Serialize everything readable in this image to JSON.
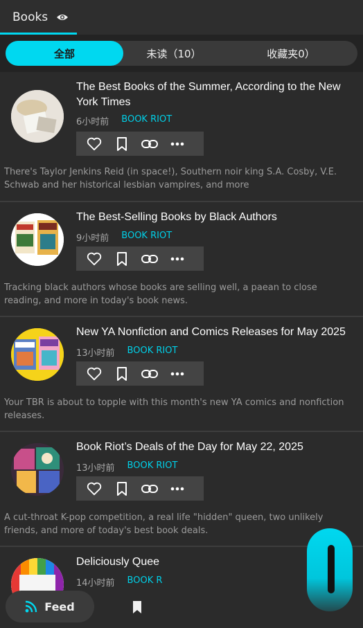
{
  "header": {
    "tab_label": "Books",
    "tab_icon": "eye-icon"
  },
  "filters": {
    "all": "全部",
    "unread": "未读（10）",
    "favorites": "收藏夹0）"
  },
  "accent": "#00d8f0",
  "articles": [
    {
      "title": "The Best Books of the Summer, According to the New York Times",
      "time": "6小时前",
      "source": "BOOK RIOT",
      "description": "There's Taylor Jenkins Reid (in space!), Southern noir king S.A. Cosby, V.E. Schwab and her historical lesbian vampires, and more"
    },
    {
      "title": "The Best-Selling Books by Black Authors",
      "time": "9小时前",
      "source": "BOOK RIOT",
      "description": "Tracking black authors whose books are selling well, a paean to close reading, and more in today's book news."
    },
    {
      "title": "New YA Nonfiction and Comics Releases for May 2025",
      "time": "13小时前",
      "source": "BOOK RIOT",
      "description": "Your TBR is about to topple with this month's new YA comics and nonfiction releases."
    },
    {
      "title": "Book Riot’s Deals of the Day for May 22, 2025",
      "time": "13小时前",
      "source": "BOOK RIOT",
      "description": "A cut-throat K-pop competition, a real life \"hidden\" queen, two unlikely friends, and more of today's best book deals."
    },
    {
      "title": "Deliciously Quee",
      "time": "14小时前",
      "source": "BOOK R"
    }
  ],
  "nav": {
    "feed_label": "Feed"
  }
}
